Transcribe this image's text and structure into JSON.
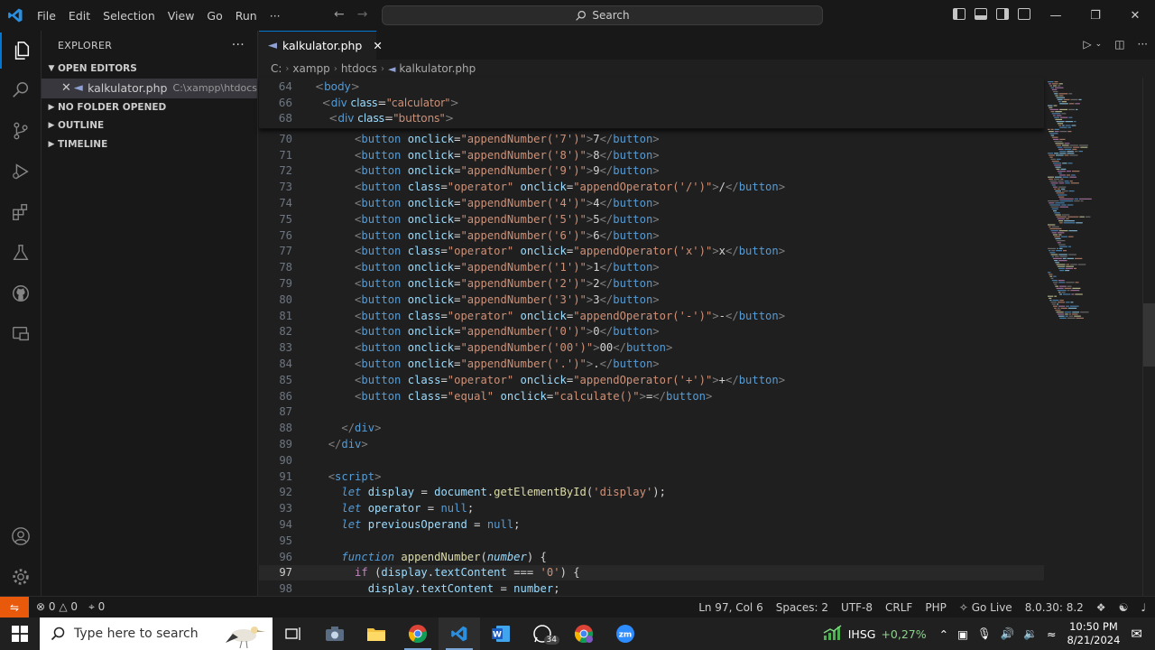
{
  "menu": [
    "File",
    "Edit",
    "Selection",
    "View",
    "Go",
    "Run",
    "···"
  ],
  "search": {
    "label": "Search"
  },
  "sidebar": {
    "title": "EXPLORER",
    "sections": {
      "open_editors": "OPEN EDITORS",
      "no_folder": "NO FOLDER OPENED",
      "outline": "OUTLINE",
      "timeline": "TIMELINE"
    },
    "open_file": {
      "name": "kalkulator.php",
      "path": "C:\\xampp\\htdocs"
    }
  },
  "tab": {
    "label": "kalkulator.php"
  },
  "breadcrumbs": [
    "C:",
    "xampp",
    "htdocs",
    "kalkulator.php"
  ],
  "sticky_lines": [
    {
      "n": "64",
      "html": "<span class='tg'>&lt;</span><span class='tn'>body</span><span class='tg'>&gt;</span>"
    },
    {
      "n": "66",
      "html": "  <span class='tg'>&lt;</span><span class='tn'>div</span> <span class='at'>class</span><span class='op'>=</span><span class='st'>\"calculator\"</span><span class='tg'>&gt;</span>"
    },
    {
      "n": "68",
      "html": "    <span class='tg'>&lt;</span><span class='tn'>div</span> <span class='at'>class</span><span class='op'>=</span><span class='st'>\"buttons\"</span><span class='tg'>&gt;</span>"
    }
  ],
  "code_lines": [
    {
      "n": "70",
      "html": "      <span class='tg'>&lt;</span><span class='tn'>button</span> <span class='at'>onclick</span><span class='op'>=</span><span class='st'>\"appendNumber('7')\"</span><span class='tg'>&gt;</span><span class='pl'>7</span><span class='tg'>&lt;/</span><span class='tn'>button</span><span class='tg'>&gt;</span>"
    },
    {
      "n": "71",
      "html": "      <span class='tg'>&lt;</span><span class='tn'>button</span> <span class='at'>onclick</span><span class='op'>=</span><span class='st'>\"appendNumber('8')\"</span><span class='tg'>&gt;</span><span class='pl'>8</span><span class='tg'>&lt;/</span><span class='tn'>button</span><span class='tg'>&gt;</span>"
    },
    {
      "n": "72",
      "html": "      <span class='tg'>&lt;</span><span class='tn'>button</span> <span class='at'>onclick</span><span class='op'>=</span><span class='st'>\"appendNumber('9')\"</span><span class='tg'>&gt;</span><span class='pl'>9</span><span class='tg'>&lt;/</span><span class='tn'>button</span><span class='tg'>&gt;</span>"
    },
    {
      "n": "73",
      "html": "      <span class='tg'>&lt;</span><span class='tn'>button</span> <span class='at'>class</span><span class='op'>=</span><span class='st'>\"operator\"</span> <span class='at'>onclick</span><span class='op'>=</span><span class='st'>\"appendOperator('/')\"</span><span class='tg'>&gt;</span><span class='pl'>/</span><span class='tg'>&lt;/</span><span class='tn'>button</span><span class='tg'>&gt;</span>"
    },
    {
      "n": "74",
      "html": "      <span class='tg'>&lt;</span><span class='tn'>button</span> <span class='at'>onclick</span><span class='op'>=</span><span class='st'>\"appendNumber('4')\"</span><span class='tg'>&gt;</span><span class='pl'>4</span><span class='tg'>&lt;/</span><span class='tn'>button</span><span class='tg'>&gt;</span>"
    },
    {
      "n": "75",
      "html": "      <span class='tg'>&lt;</span><span class='tn'>button</span> <span class='at'>onclick</span><span class='op'>=</span><span class='st'>\"appendNumber('5')\"</span><span class='tg'>&gt;</span><span class='pl'>5</span><span class='tg'>&lt;/</span><span class='tn'>button</span><span class='tg'>&gt;</span>"
    },
    {
      "n": "76",
      "html": "      <span class='tg'>&lt;</span><span class='tn'>button</span> <span class='at'>onclick</span><span class='op'>=</span><span class='st'>\"appendNumber('6')\"</span><span class='tg'>&gt;</span><span class='pl'>6</span><span class='tg'>&lt;/</span><span class='tn'>button</span><span class='tg'>&gt;</span>"
    },
    {
      "n": "77",
      "html": "      <span class='tg'>&lt;</span><span class='tn'>button</span> <span class='at'>class</span><span class='op'>=</span><span class='st'>\"operator\"</span> <span class='at'>onclick</span><span class='op'>=</span><span class='st'>\"appendOperator('x')\"</span><span class='tg'>&gt;</span><span class='pl'>x</span><span class='tg'>&lt;/</span><span class='tn'>button</span><span class='tg'>&gt;</span>"
    },
    {
      "n": "78",
      "html": "      <span class='tg'>&lt;</span><span class='tn'>button</span> <span class='at'>onclick</span><span class='op'>=</span><span class='st'>\"appendNumber('1')\"</span><span class='tg'>&gt;</span><span class='pl'>1</span><span class='tg'>&lt;/</span><span class='tn'>button</span><span class='tg'>&gt;</span>"
    },
    {
      "n": "79",
      "html": "      <span class='tg'>&lt;</span><span class='tn'>button</span> <span class='at'>onclick</span><span class='op'>=</span><span class='st'>\"appendNumber('2')\"</span><span class='tg'>&gt;</span><span class='pl'>2</span><span class='tg'>&lt;/</span><span class='tn'>button</span><span class='tg'>&gt;</span>"
    },
    {
      "n": "80",
      "html": "      <span class='tg'>&lt;</span><span class='tn'>button</span> <span class='at'>onclick</span><span class='op'>=</span><span class='st'>\"appendNumber('3')\"</span><span class='tg'>&gt;</span><span class='pl'>3</span><span class='tg'>&lt;/</span><span class='tn'>button</span><span class='tg'>&gt;</span>"
    },
    {
      "n": "81",
      "html": "      <span class='tg'>&lt;</span><span class='tn'>button</span> <span class='at'>class</span><span class='op'>=</span><span class='st'>\"operator\"</span> <span class='at'>onclick</span><span class='op'>=</span><span class='st'>\"appendOperator('-')\"</span><span class='tg'>&gt;</span><span class='pl'>-</span><span class='tg'>&lt;/</span><span class='tn'>button</span><span class='tg'>&gt;</span>"
    },
    {
      "n": "82",
      "html": "      <span class='tg'>&lt;</span><span class='tn'>button</span> <span class='at'>onclick</span><span class='op'>=</span><span class='st'>\"appendNumber('0')\"</span><span class='tg'>&gt;</span><span class='pl'>0</span><span class='tg'>&lt;/</span><span class='tn'>button</span><span class='tg'>&gt;</span>"
    },
    {
      "n": "83",
      "html": "      <span class='tg'>&lt;</span><span class='tn'>button</span> <span class='at'>onclick</span><span class='op'>=</span><span class='st'>\"appendNumber('00')\"</span><span class='tg'>&gt;</span><span class='pl'>00</span><span class='tg'>&lt;/</span><span class='tn'>button</span><span class='tg'>&gt;</span>"
    },
    {
      "n": "84",
      "html": "      <span class='tg'>&lt;</span><span class='tn'>button</span> <span class='at'>onclick</span><span class='op'>=</span><span class='st'>\"appendNumber('.')\"</span><span class='tg'>&gt;</span><span class='pl'>.</span><span class='tg'>&lt;/</span><span class='tn'>button</span><span class='tg'>&gt;</span>"
    },
    {
      "n": "85",
      "html": "      <span class='tg'>&lt;</span><span class='tn'>button</span> <span class='at'>class</span><span class='op'>=</span><span class='st'>\"operator\"</span> <span class='at'>onclick</span><span class='op'>=</span><span class='st'>\"appendOperator('+')\"</span><span class='tg'>&gt;</span><span class='pl'>+</span><span class='tg'>&lt;/</span><span class='tn'>button</span><span class='tg'>&gt;</span>"
    },
    {
      "n": "86",
      "html": "      <span class='tg'>&lt;</span><span class='tn'>button</span> <span class='at'>class</span><span class='op'>=</span><span class='st'>\"equal\"</span> <span class='at'>onclick</span><span class='op'>=</span><span class='st'>\"calculate()\"</span><span class='tg'>&gt;</span><span class='pl'>=</span><span class='tg'>&lt;/</span><span class='tn'>button</span><span class='tg'>&gt;</span>"
    },
    {
      "n": "87",
      "html": ""
    },
    {
      "n": "88",
      "html": "    <span class='tg'>&lt;/</span><span class='tn'>div</span><span class='tg'>&gt;</span>"
    },
    {
      "n": "89",
      "html": "  <span class='tg'>&lt;/</span><span class='tn'>div</span><span class='tg'>&gt;</span>"
    },
    {
      "n": "90",
      "html": ""
    },
    {
      "n": "91",
      "html": "  <span class='tg'>&lt;</span><span class='tn'>script</span><span class='tg'>&gt;</span>"
    },
    {
      "n": "92",
      "html": "    <span class='kw'>let</span> <span class='vr'>display</span> <span class='op'>=</span> <span class='vr'>document</span><span class='op'>.</span><span class='fn'>getElementById</span><span class='op'>(</span><span class='st'>'display'</span><span class='op'>);</span>"
    },
    {
      "n": "93",
      "html": "    <span class='kw'>let</span> <span class='vr'>operator</span> <span class='op'>=</span> <span class='nl'>null</span><span class='op'>;</span>"
    },
    {
      "n": "94",
      "html": "    <span class='kw'>let</span> <span class='vr'>previousOperand</span> <span class='op'>=</span> <span class='nl'>null</span><span class='op'>;</span>"
    },
    {
      "n": "95",
      "html": ""
    },
    {
      "n": "96",
      "html": "    <span class='kw'>function</span> <span class='fn'>appendNumber</span><span class='op'>(</span><span class='pr'>number</span><span class='op'>) {</span>"
    },
    {
      "n": "97",
      "html": "      <span class='cf'>if</span> <span class='op'>(</span><span class='vr'>display</span><span class='op'>.</span><span class='vr'>textContent</span> <span class='op'>===</span> <span class='st'>'0'</span><span class='op'>) {</span>",
      "current": true
    },
    {
      "n": "98",
      "html": "        <span class='vr'>display</span><span class='op'>.</span><span class='vr'>textContent</span> <span class='op'>=</span> <span class='vr'>number</span><span class='op'>;</span>"
    }
  ],
  "status": {
    "errors": "0",
    "warnings": "0",
    "ports": "0",
    "position": "Ln 97, Col 6",
    "spaces": "Spaces: 2",
    "encoding": "UTF-8",
    "eol": "CRLF",
    "language": "PHP",
    "golive": "Go Live",
    "php_version": "8.0.30: 8.2"
  },
  "taskbar": {
    "search_placeholder": "Type here to search",
    "whatsapp_badge": "34",
    "stock_name": "IHSG",
    "stock_change": "+0,27%",
    "time": "10:50 PM",
    "date": "8/21/2024"
  },
  "colors": {
    "accent": "#0078d4",
    "remote": "#e8590c",
    "stock_up": "#4caf50"
  }
}
